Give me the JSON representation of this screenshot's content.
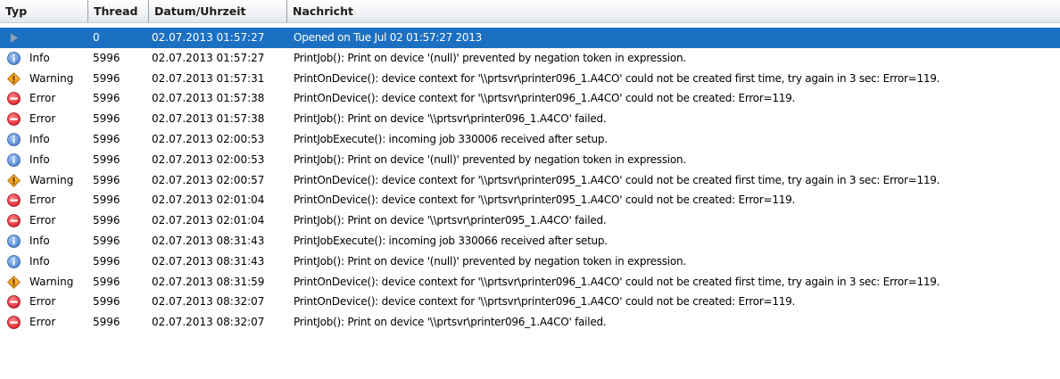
{
  "columns": {
    "type": "Typ",
    "thread": "Thread",
    "date": "Datum/Uhrzeit",
    "message": "Nachricht"
  },
  "colors": {
    "selection": "#1c70c2",
    "info": "#4a7fd0",
    "warning": "#f0a020",
    "error": "#d81e2a"
  },
  "rows": [
    {
      "icon": "play-icon",
      "type": "",
      "thread": "0",
      "datetime": "02.07.2013 01:57:27",
      "message": "Opened on Tue Jul 02 01:57:27 2013",
      "selected": true
    },
    {
      "icon": "info-icon",
      "type": "Info",
      "thread": "5996",
      "datetime": "02.07.2013 01:57:27",
      "message": "PrintJob(): Print on device '(null)' prevented by negation token in expression."
    },
    {
      "icon": "warning-icon",
      "type": "Warning",
      "thread": "5996",
      "datetime": "02.07.2013 01:57:31",
      "message": "PrintOnDevice(): device context for '\\\\prtsvr\\printer096_1.A4CO' could not be created first time, try again in 3 sec: Error=119."
    },
    {
      "icon": "error-icon",
      "type": "Error",
      "thread": "5996",
      "datetime": "02.07.2013 01:57:38",
      "message": "PrintOnDevice(): device context for '\\\\prtsvr\\printer096_1.A4CO' could not be created: Error=119."
    },
    {
      "icon": "error-icon",
      "type": "Error",
      "thread": "5996",
      "datetime": "02.07.2013 01:57:38",
      "message": "PrintJob(): Print on device '\\\\prtsvr\\printer096_1.A4CO' failed."
    },
    {
      "icon": "info-icon",
      "type": "Info",
      "thread": "5996",
      "datetime": "02.07.2013 02:00:53",
      "message": "PrintJobExecute(): incoming job 330006 received after setup."
    },
    {
      "icon": "info-icon",
      "type": "Info",
      "thread": "5996",
      "datetime": "02.07.2013 02:00:53",
      "message": "PrintJob(): Print on device '(null)' prevented by negation token in expression."
    },
    {
      "icon": "warning-icon",
      "type": "Warning",
      "thread": "5996",
      "datetime": "02.07.2013 02:00:57",
      "message": "PrintOnDevice(): device context for '\\\\prtsvr\\printer095_1.A4CO' could not be created first time, try again in 3 sec: Error=119."
    },
    {
      "icon": "error-icon",
      "type": "Error",
      "thread": "5996",
      "datetime": "02.07.2013 02:01:04",
      "message": "PrintOnDevice(): device context for '\\\\prtsvr\\printer095_1.A4CO' could not be created: Error=119."
    },
    {
      "icon": "error-icon",
      "type": "Error",
      "thread": "5996",
      "datetime": "02.07.2013 02:01:04",
      "message": "PrintJob(): Print on device '\\\\prtsvr\\printer095_1.A4CO' failed."
    },
    {
      "icon": "info-icon",
      "type": "Info",
      "thread": "5996",
      "datetime": "02.07.2013 08:31:43",
      "message": "PrintJobExecute(): incoming job 330066 received after setup."
    },
    {
      "icon": "info-icon",
      "type": "Info",
      "thread": "5996",
      "datetime": "02.07.2013 08:31:43",
      "message": "PrintJob(): Print on device '(null)' prevented by negation token in expression."
    },
    {
      "icon": "warning-icon",
      "type": "Warning",
      "thread": "5996",
      "datetime": "02.07.2013 08:31:59",
      "message": "PrintOnDevice(): device context for '\\\\prtsvr\\printer096_1.A4CO' could not be created first time, try again in 3 sec: Error=119."
    },
    {
      "icon": "error-icon",
      "type": "Error",
      "thread": "5996",
      "datetime": "02.07.2013 08:32:07",
      "message": "PrintOnDevice(): device context for '\\\\prtsvr\\printer096_1.A4CO' could not be created: Error=119."
    },
    {
      "icon": "error-icon",
      "type": "Error",
      "thread": "5996",
      "datetime": "02.07.2013 08:32:07",
      "message": "PrintJob(): Print on device '\\\\prtsvr\\printer096_1.A4CO' failed."
    }
  ]
}
